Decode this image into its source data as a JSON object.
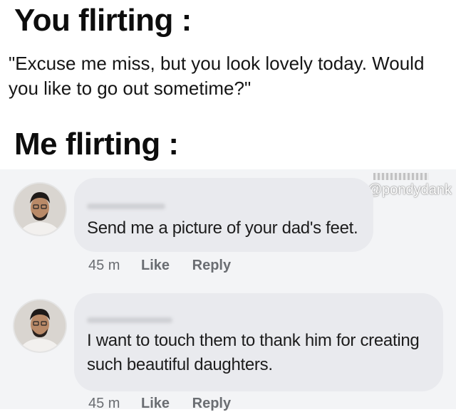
{
  "meme": {
    "you_heading": "You flirting :",
    "you_quote": "\"Excuse me miss, but you look lovely today. Would you like to go out sometime?\"",
    "me_heading": "Me flirting :"
  },
  "watermark": {
    "handle": "@pondydank"
  },
  "comments": [
    {
      "text": "Send me a picture of your dad's feet.",
      "time": "45 m",
      "like_label": "Like",
      "reply_label": "Reply"
    },
    {
      "text": "I want to touch them to thank him for creating such beautiful daughters.",
      "time": "45 m",
      "like_label": "Like",
      "reply_label": "Reply"
    }
  ],
  "colors": {
    "page_background": "#ffffff",
    "comment_area": "#f3f4f6",
    "bubble": "#e9eaee",
    "meta_text": "#6a6d72"
  }
}
